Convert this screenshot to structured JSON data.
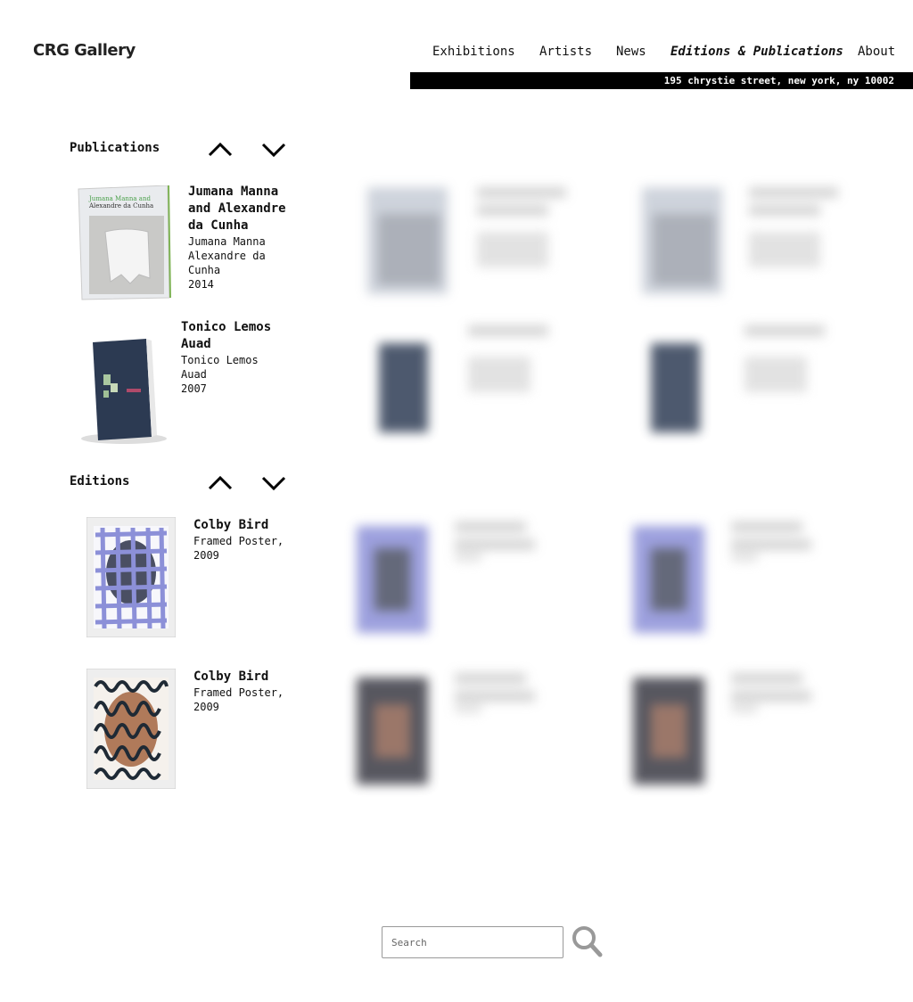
{
  "header": {
    "logo": "CRG Gallery",
    "nav": [
      "Exhibitions",
      "Artists",
      "News",
      "Editions & Publications",
      "About"
    ],
    "active": "Editions & Publications",
    "address": "195 chrystie street, new york, ny 10002"
  },
  "publications": {
    "title": "Publications",
    "items": [
      {
        "title": "Jumana Manna and Alexandre da Cunha",
        "artists": "Jumana Manna Alexandre da Cunha",
        "year": "2014",
        "cover_text_1": "Jumana Manna and",
        "cover_text_2": "Alexandre da Cunha"
      },
      {
        "title": "Tonico Lemos Auad",
        "artists": "Tonico Lemos Auad",
        "year": "2007"
      }
    ]
  },
  "editions": {
    "title": "Editions",
    "items": [
      {
        "title": "Colby Bird",
        "desc": "Framed Poster, 2009"
      },
      {
        "title": "Colby Bird",
        "desc": "Framed Poster, 2009"
      }
    ]
  },
  "search": {
    "placeholder": "Search"
  },
  "colors": {
    "accent": "#000000",
    "cover_blue": "#2c3a52",
    "grid_blue": "#8c90d8"
  },
  "icons": [
    "chevron-up-icon",
    "chevron-down-icon",
    "search-icon"
  ]
}
